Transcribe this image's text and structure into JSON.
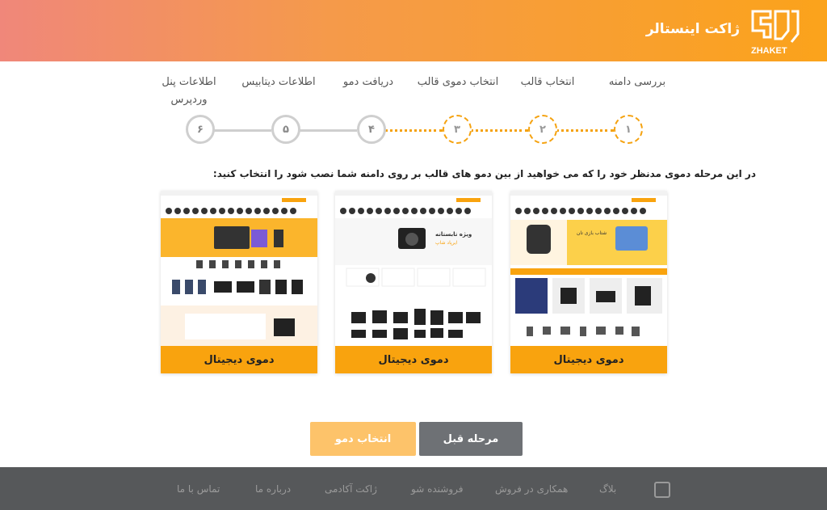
{
  "header": {
    "title": "ژاکت اینستالر",
    "logo_wordmark": "ZHAKET"
  },
  "steps": [
    {
      "number": "۱",
      "label": "بررسی دامنه",
      "state": "done"
    },
    {
      "number": "۲",
      "label": "انتخاب قالب",
      "state": "done"
    },
    {
      "number": "۳",
      "label": "انتخاب دموی قالب",
      "state": "done"
    },
    {
      "number": "۴",
      "label": "دریافت دمو",
      "state": "todo"
    },
    {
      "number": "۵",
      "label": "اطلاعات دیتابیس",
      "state": "todo"
    },
    {
      "number": "۶",
      "label": "اطلاعات پنل وردپرس",
      "state": "todo"
    }
  ],
  "instruction": "در این مرحله دموی مدنظر خود را که می خواهید از بین دمو های قالب بر روی دامنه شما نصب شود را انتخاب کنید:",
  "demos": [
    {
      "label": "دموی دیجیتال",
      "banner_title": "ویژه تابستانه",
      "banner_sub": "ایرپاد شاپ"
    },
    {
      "label": "دموی دیجیتال"
    },
    {
      "label": "دموی دیجیتال",
      "banner_title": "شتاب بازی تان"
    }
  ],
  "buttons": {
    "prev": "مرحله قبل",
    "select": "انتخاب دمو"
  },
  "footer": {
    "links": [
      "بلاگ",
      "همکاری در فروش",
      "فروشنده شو",
      "ژاکت آکادمی",
      "درباره ما",
      "تماس با ما"
    ]
  },
  "colors": {
    "accent": "#f9a30e",
    "header_start": "#f0877a",
    "header_end": "#fba31b",
    "footer_bg": "#56585a"
  }
}
